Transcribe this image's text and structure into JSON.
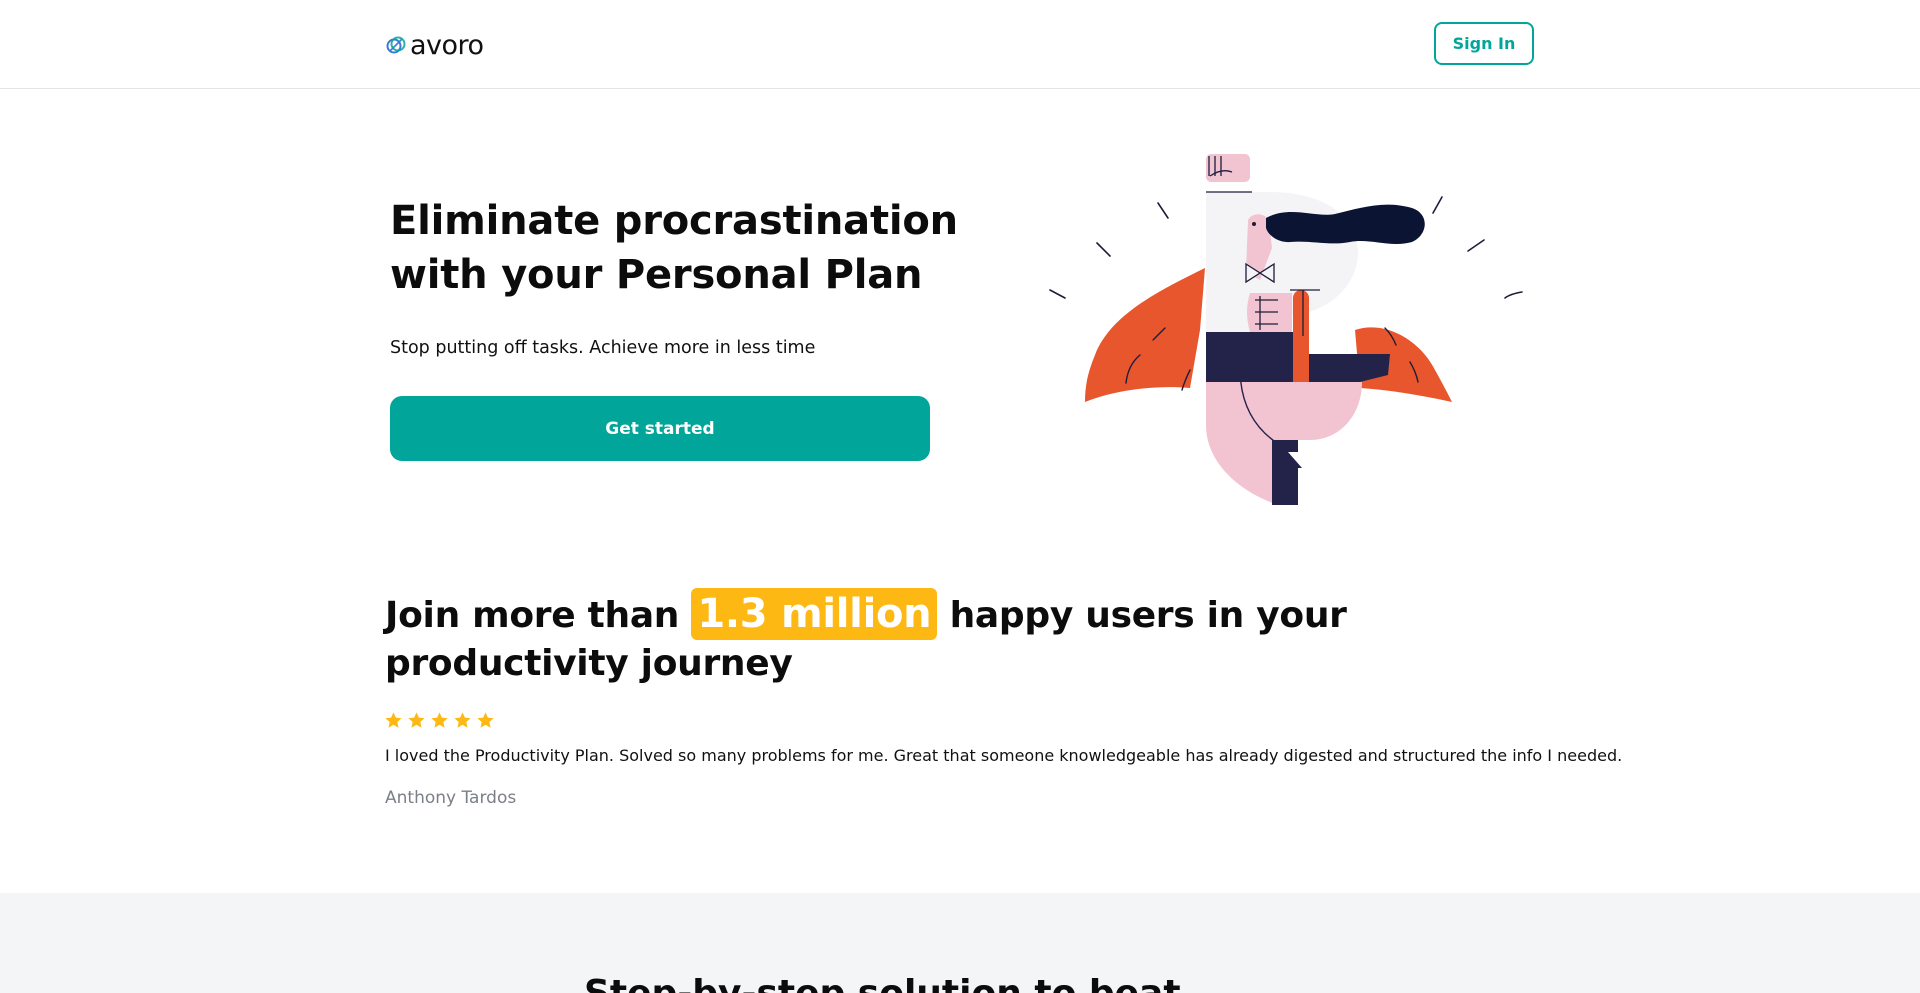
{
  "header": {
    "logo_text": "avoro",
    "signin_label": "Sign In"
  },
  "hero": {
    "title_line1": "Eliminate procrastination",
    "title_line2": "with your Personal Plan",
    "subtitle": "Stop putting off tasks. Achieve more in less time",
    "cta_label": "Get started",
    "illustration_icon": "superhero-letter-p-illustration"
  },
  "proof": {
    "title_before": "Join more than",
    "title_highlight": "1.3 million",
    "title_after": "happy users in your productivity journey",
    "rating_stars": 5,
    "review_text": "I loved the Productivity Plan. Solved so many problems for me. Great that someone knowledgeable has already digested and structured the info I needed.",
    "review_author": "Anthony Tardos"
  },
  "next_section": {
    "title": "Step-by-step solution to beat"
  },
  "colors": {
    "accent": "#02a59a",
    "highlight": "#fdb813",
    "cape": "#e8562d",
    "pink": "#f2c4d1",
    "navy": "#23234a",
    "star": "#fdb813"
  }
}
